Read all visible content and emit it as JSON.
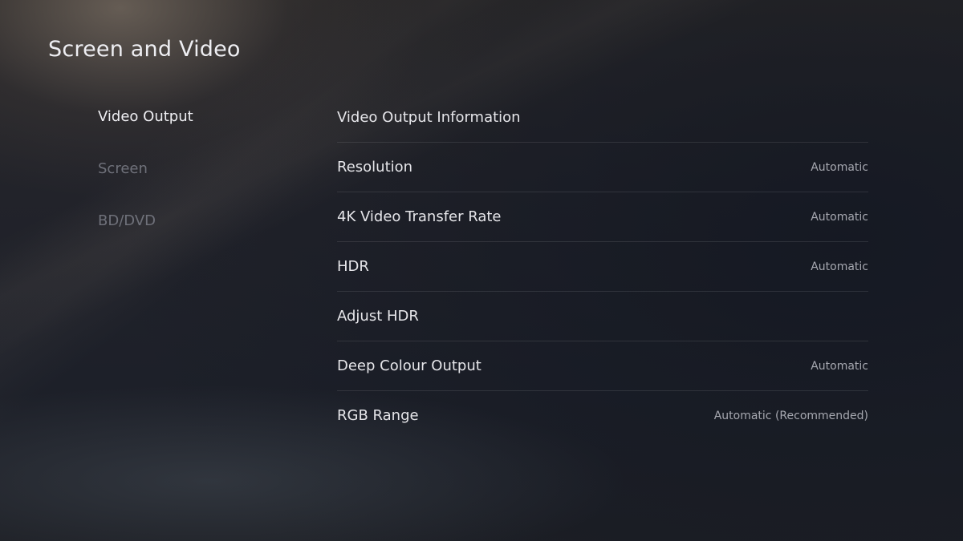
{
  "page": {
    "title": "Screen and Video"
  },
  "sidebar": {
    "items": [
      {
        "label": "Video Output",
        "active": true
      },
      {
        "label": "Screen",
        "active": false
      },
      {
        "label": "BD/DVD",
        "active": false
      }
    ]
  },
  "settings": {
    "rows": [
      {
        "label": "Video Output Information",
        "value": ""
      },
      {
        "label": "Resolution",
        "value": "Automatic"
      },
      {
        "label": "4K Video Transfer Rate",
        "value": "Automatic"
      },
      {
        "label": "HDR",
        "value": "Automatic"
      },
      {
        "label": "Adjust HDR",
        "value": ""
      },
      {
        "label": "Deep Colour Output",
        "value": "Automatic"
      },
      {
        "label": "RGB Range",
        "value": "Automatic (Recommended)"
      }
    ]
  }
}
